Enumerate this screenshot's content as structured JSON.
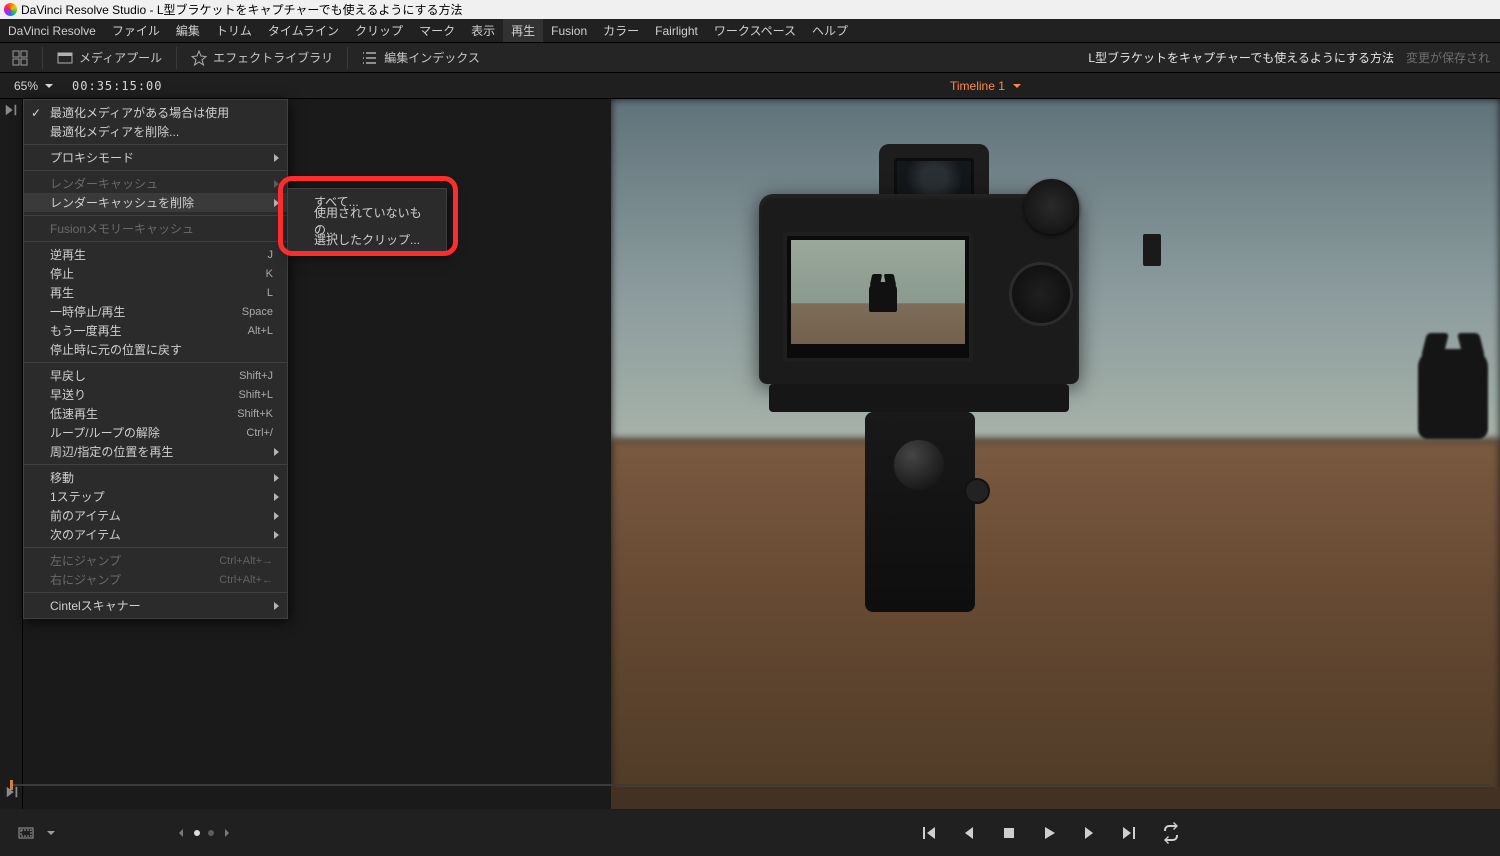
{
  "app_title": "DaVinci Resolve Studio - L型ブラケットをキャプチャーでも使えるようにする方法",
  "menubar": [
    "DaVinci Resolve",
    "ファイル",
    "編集",
    "トリム",
    "タイムライン",
    "クリップ",
    "マーク",
    "表示",
    "再生",
    "Fusion",
    "カラー",
    "Fairlight",
    "ワークスペース",
    "ヘルプ"
  ],
  "menubar_open_index": 8,
  "toolbar": {
    "media_pool": "メディアプール",
    "effects_library": "エフェクトライブラリ",
    "edit_index": "編集インデックス"
  },
  "header": {
    "project_name": "L型ブラケットをキャプチャーでも使えるようにする方法",
    "save_state": "変更が保存され"
  },
  "zoom": {
    "value": "65%",
    "timecode": "00:35:15:00"
  },
  "timeline": {
    "name": "Timeline 1"
  },
  "playback_menu": [
    {
      "label": "最適化メディアがある場合は使用",
      "checked": true
    },
    {
      "label": "最適化メディアを削除..."
    },
    {
      "sep": true
    },
    {
      "label": "プロキシモード",
      "sub": true
    },
    {
      "sep": true
    },
    {
      "label": "レンダーキャッシュ",
      "sub": true,
      "disabled": true
    },
    {
      "label": "レンダーキャッシュを削除",
      "sub": true,
      "highlight": true
    },
    {
      "sep": true
    },
    {
      "label": "Fusionメモリーキャッシュ",
      "disabled": true
    },
    {
      "sep": true
    },
    {
      "label": "逆再生",
      "shortcut": "J"
    },
    {
      "label": "停止",
      "shortcut": "K"
    },
    {
      "label": "再生",
      "shortcut": "L"
    },
    {
      "label": "一時停止/再生",
      "shortcut": "Space"
    },
    {
      "label": "もう一度再生",
      "shortcut": "Alt+L"
    },
    {
      "label": "停止時に元の位置に戻す"
    },
    {
      "sep": true
    },
    {
      "label": "早戻し",
      "shortcut": "Shift+J"
    },
    {
      "label": "早送り",
      "shortcut": "Shift+L"
    },
    {
      "label": "低速再生",
      "shortcut": "Shift+K"
    },
    {
      "label": "ループ/ループの解除",
      "shortcut": "Ctrl+/"
    },
    {
      "label": "周辺/指定の位置を再生",
      "sub": true
    },
    {
      "sep": true
    },
    {
      "label": "移動",
      "sub": true
    },
    {
      "label": "1ステップ",
      "sub": true
    },
    {
      "label": "前のアイテム",
      "sub": true
    },
    {
      "label": "次のアイテム",
      "sub": true
    },
    {
      "sep": true
    },
    {
      "label": "左にジャンプ",
      "shortcut": "Ctrl+Alt+→",
      "disabled": true
    },
    {
      "label": "右にジャンプ",
      "shortcut": "Ctrl+Alt+←",
      "disabled": true
    },
    {
      "sep": true
    },
    {
      "label": "Cintelスキャナー",
      "sub": true
    }
  ],
  "submenu": [
    "すべて...",
    "使用されていないもの...",
    "選択したクリップ..."
  ]
}
